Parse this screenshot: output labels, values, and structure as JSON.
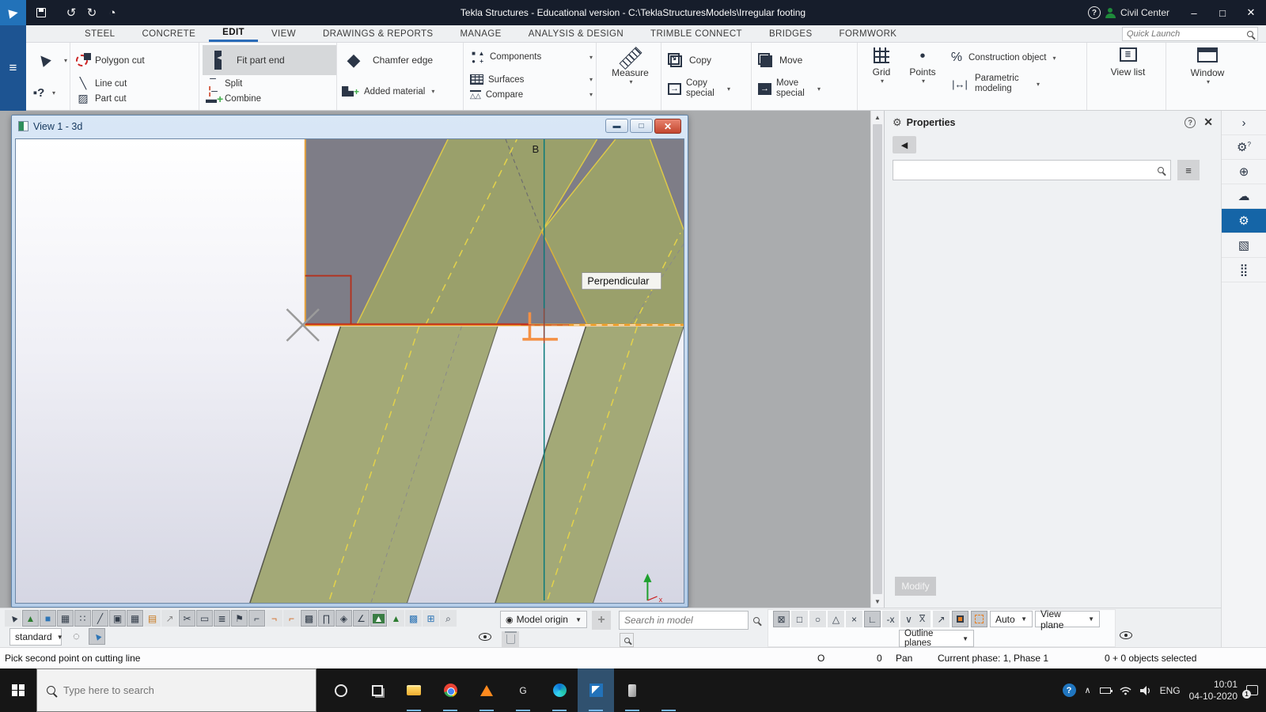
{
  "titlebar": {
    "title": "Tekla Structures - Educational version - C:\\TeklaStructuresModels\\Irregular footing",
    "user": "Civil Center"
  },
  "tabs": [
    {
      "id": "steel",
      "label": "STEEL"
    },
    {
      "id": "concrete",
      "label": "CONCRETE"
    },
    {
      "id": "edit",
      "label": "EDIT",
      "active": true
    },
    {
      "id": "view",
      "label": "VIEW"
    },
    {
      "id": "drawings-reports",
      "label": "DRAWINGS & REPORTS"
    },
    {
      "id": "manage",
      "label": "MANAGE"
    },
    {
      "id": "analysis-design",
      "label": "ANALYSIS & DESIGN"
    },
    {
      "id": "trimble-connect",
      "label": "TRIMBLE CONNECT"
    },
    {
      "id": "bridges",
      "label": "BRIDGES"
    },
    {
      "id": "formwork",
      "label": "FORMWORK"
    }
  ],
  "quick_launch": {
    "placeholder": "Quick Launch"
  },
  "ribbon": {
    "polygon_cut": "Polygon cut",
    "line_cut": "Line cut",
    "part_cut": "Part cut",
    "fit_part_end": "Fit part end",
    "split": "Split",
    "combine": "Combine",
    "chamfer_edge": "Chamfer edge",
    "added_material": "Added material",
    "components": "Components",
    "surfaces": "Surfaces",
    "compare": "Compare",
    "measure": "Measure",
    "copy": "Copy",
    "copy_special": "Copy special",
    "move": "Move",
    "move_special": "Move special",
    "grid": "Grid",
    "points": "Points",
    "construction_object": "Construction object",
    "parametric_modeling": "Parametric modeling",
    "view_list": "View list",
    "window": "Window"
  },
  "view": {
    "title": "View 1 - 3d",
    "grid_label": "B",
    "tooltip": "Perpendicular",
    "axis_x": "x",
    "colors": {
      "face_gray": "#7e7d87",
      "band_green": "#9aa06b",
      "lower_green": "#a3a977",
      "edge_yellow": "#dcc84a",
      "edge_orange": "#efa02c",
      "cut_red": "#b5301c",
      "axis_teal": "#0c7b7b"
    }
  },
  "properties": {
    "title": "Properties",
    "modify_label": "Modify"
  },
  "panel_strip": [
    {
      "n": "collapse",
      "g": "›"
    },
    {
      "n": "settings-search",
      "g": "⚙",
      "sup": "?"
    },
    {
      "n": "web",
      "g": "⊕"
    },
    {
      "n": "cloud",
      "g": "☁"
    },
    {
      "n": "settings",
      "g": "⚙",
      "sel": 1
    },
    {
      "n": "model",
      "g": "▧"
    },
    {
      "n": "components",
      "g": "⣿"
    }
  ],
  "bars": {
    "row1_icons": [
      {
        "n": "select-cursor",
        "g": "►",
        "cls": "rot"
      },
      {
        "n": "select-parts",
        "g": "▲",
        "c": "#2e7d32",
        "p": 1
      },
      {
        "n": "select-surfaces",
        "g": "■",
        "c": "#2e75b6",
        "p": 1
      },
      {
        "n": "select-grid",
        "g": "▦",
        "p": 1
      },
      {
        "n": "select-points",
        "g": "∷",
        "p": 1
      },
      {
        "n": "select-lines",
        "g": "╱",
        "p": 1
      },
      {
        "n": "select-objects-3d",
        "g": "▣",
        "p": 1
      },
      {
        "n": "select-grid-lines",
        "g": "▦",
        "p": 1
      },
      {
        "n": "select-grid-planes",
        "g": "▤",
        "c": "#c8781e"
      },
      {
        "n": "select-reference",
        "g": "↗",
        "c": "#888"
      },
      {
        "n": "select-cuts",
        "g": "✂",
        "p": 1
      },
      {
        "n": "select-views",
        "g": "▭",
        "p": 1
      },
      {
        "n": "select-fittings",
        "g": "≣",
        "p": 1
      },
      {
        "n": "select-flags",
        "g": "⚑",
        "p": 1
      },
      {
        "n": "select-welds",
        "g": "⌐",
        "p": 1
      },
      {
        "n": "select-welds-secondary",
        "g": "¬",
        "c": "#d2691e"
      },
      {
        "n": "select-joints",
        "g": "⌐",
        "c": "#d2691e"
      },
      {
        "n": "select-reinforcement",
        "g": "▩",
        "p": 1
      },
      {
        "n": "select-bolts",
        "g": "∏",
        "p": 1
      },
      {
        "n": "select-planes",
        "g": "◈",
        "p": 1
      },
      {
        "n": "select-distances",
        "g": "∠",
        "p": 1
      },
      {
        "n": "select-areas",
        "g": "▲",
        "c": "#ffffff",
        "bg": "#3a7d44",
        "p": 1
      },
      {
        "n": "select-single-point",
        "g": "▲",
        "c": "#2e7d32"
      },
      {
        "n": "select-components-pattern",
        "g": "▩",
        "c": "#2e75b6"
      },
      {
        "n": "select-assemblies",
        "g": "⊞",
        "c": "#2e75b6"
      },
      {
        "n": "zoom-select",
        "g": "⌕"
      }
    ],
    "standard_preset": "standard",
    "model_origin": "Model origin",
    "search_placeholder": "Search in model",
    "snap1_icons": [
      {
        "n": "snap-reference-points",
        "g": "⊠",
        "p": 1
      },
      {
        "n": "snap-geometry-points",
        "g": "□"
      },
      {
        "n": "snap-center-points",
        "g": "○"
      },
      {
        "n": "snap-midpoints",
        "g": "△"
      },
      {
        "n": "snap-intersections",
        "g": "×"
      },
      {
        "n": "snap-perpendicular",
        "g": "∟",
        "p": 1
      },
      {
        "n": "snap-extension",
        "g": "-x"
      },
      {
        "n": "snap-more",
        "g": "∨"
      }
    ],
    "outline_planes": "Outline planes",
    "auto": "Auto",
    "view_plane": "View plane"
  },
  "status": {
    "message": "Pick second point on cutting line",
    "ortho": "O",
    "num": "0",
    "pan": "Pan",
    "phase": "Current phase: 1, Phase 1",
    "selection": "0 + 0 objects selected"
  },
  "taskbar": {
    "search_placeholder": "Type here to search",
    "apps": [
      {
        "n": "cortana"
      },
      {
        "n": "task-view"
      },
      {
        "n": "file-explorer",
        "open": 1
      },
      {
        "n": "chrome",
        "open": 1
      },
      {
        "n": "vlc",
        "open": 1
      },
      {
        "n": "gom-player",
        "letter": "G",
        "open": 1
      },
      {
        "n": "edge",
        "open": 1
      },
      {
        "n": "tekla-structures",
        "active": 1,
        "open": 1
      },
      {
        "n": "phone",
        "open": 1
      },
      {
        "n": "satellite-app",
        "open": 1
      }
    ],
    "lang": "ENG",
    "time": "10:01",
    "date": "04-10-2020",
    "badge": "1"
  }
}
